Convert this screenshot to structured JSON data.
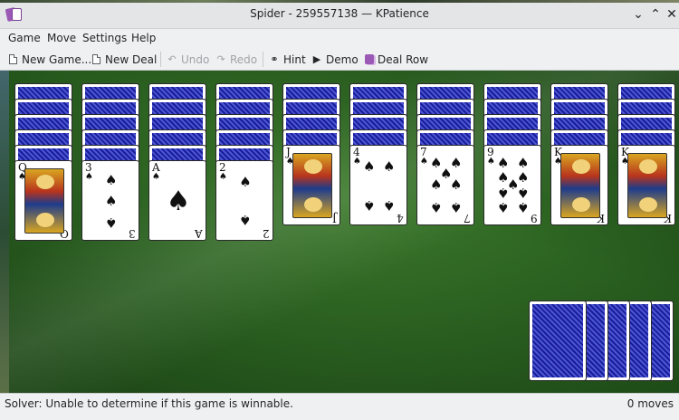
{
  "window": {
    "title": "Spider - 259557138 — KPatience",
    "controls": [
      "chevron-down-icon",
      "chevron-up-icon",
      "close-icon"
    ]
  },
  "menu": {
    "items": [
      "Game",
      "Move",
      "Settings",
      "Help"
    ]
  },
  "toolbar": {
    "new_game": "New Game...",
    "new_deal": "New Deal",
    "undo": "Undo",
    "redo": "Redo",
    "hint": "Hint",
    "demo": "Demo",
    "deal_row": "Deal Row"
  },
  "tableau": [
    {
      "face_down": 5,
      "top": {
        "rank": "Q",
        "suit": "♠"
      }
    },
    {
      "face_down": 5,
      "top": {
        "rank": "3",
        "suit": "♠"
      }
    },
    {
      "face_down": 5,
      "top": {
        "rank": "A",
        "suit": "♠"
      }
    },
    {
      "face_down": 5,
      "top": {
        "rank": "2",
        "suit": "♠"
      }
    },
    {
      "face_down": 4,
      "top": {
        "rank": "J",
        "suit": "♠"
      }
    },
    {
      "face_down": 4,
      "top": {
        "rank": "4",
        "suit": "♠"
      }
    },
    {
      "face_down": 4,
      "top": {
        "rank": "7",
        "suit": "♠"
      }
    },
    {
      "face_down": 4,
      "top": {
        "rank": "9",
        "suit": "♠"
      }
    },
    {
      "face_down": 4,
      "top": {
        "rank": "K",
        "suit": "♠"
      }
    },
    {
      "face_down": 4,
      "top": {
        "rank": "K",
        "suit": "♠"
      }
    }
  ],
  "stock": {
    "piles": 5
  },
  "status": {
    "message": "Solver: Unable to determine if this game is winnable.",
    "moves": "0 moves"
  }
}
